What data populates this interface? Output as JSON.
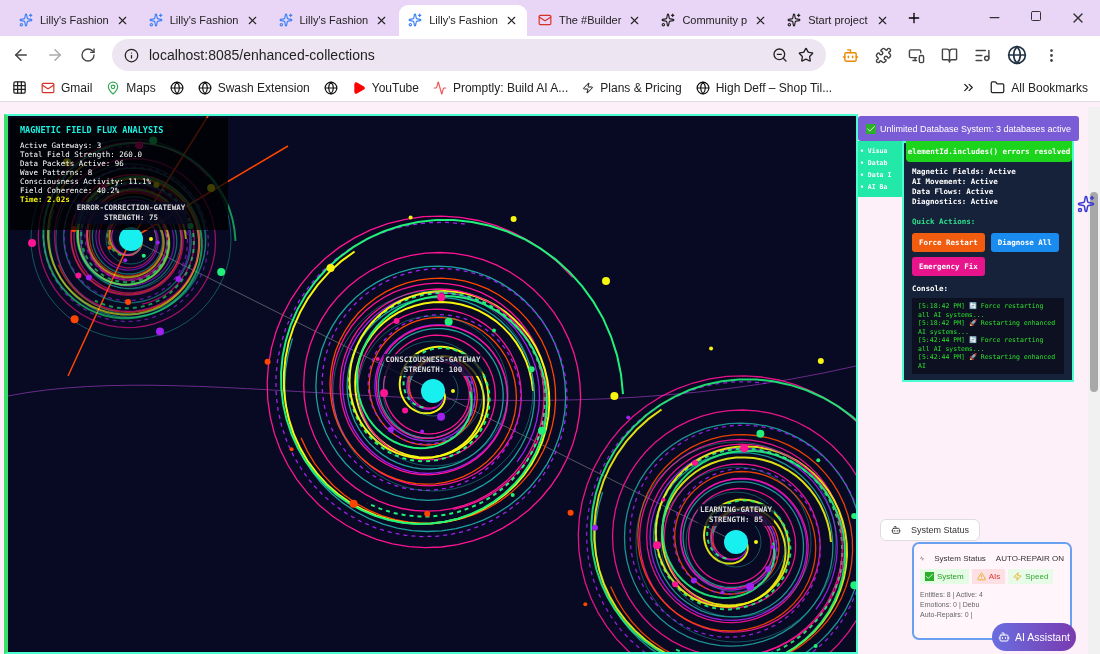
{
  "tabs": [
    {
      "title": "Lilly's Fashion",
      "kind": "app",
      "selected": false
    },
    {
      "title": "Lilly's Fashion",
      "kind": "app",
      "selected": false
    },
    {
      "title": "Lilly's Fashion",
      "kind": "app",
      "selected": false
    },
    {
      "title": "Lilly's Fashion",
      "kind": "app",
      "selected": true
    },
    {
      "title": "The #Builder",
      "kind": "mail",
      "selected": false
    },
    {
      "title": "Community p",
      "kind": "star",
      "selected": false
    },
    {
      "title": "Start project",
      "kind": "star",
      "selected": false
    }
  ],
  "address": "localhost:8085/enhanced-collections",
  "bookmarks": [
    {
      "label": "Gmail",
      "kind": "mail"
    },
    {
      "label": "Maps",
      "kind": "pin"
    },
    {
      "kind": "globe"
    },
    {
      "label": "Swash Extension",
      "kind": "globe"
    },
    {
      "kind": "globe"
    },
    {
      "label": "YouTube",
      "kind": "play"
    },
    {
      "label": "Promptly: Build AI A...",
      "kind": "prompt"
    },
    {
      "label": "Plans & Pricing",
      "kind": "wix"
    },
    {
      "label": "High Deff – Shop Til...",
      "kind": "globe"
    }
  ],
  "all_bookmarks": "All Bookmarks",
  "flux_panel": {
    "title": "MAGNETIC FIELD FLUX ANALYSIS",
    "stats": [
      "Active Gateways: 3",
      "Total Field Strength: 260.0",
      "Data Packets Active: 96",
      "Wave Patterns: 8",
      "Consciousness Activity: 11.1%",
      "Field Coherence: 40.2%"
    ],
    "time": "Time: 2.02s"
  },
  "gateways": [
    {
      "name": "ERROR-CORRECTION-GATEWAY",
      "strength": "STRENGTH: 75"
    },
    {
      "name": "CONSCIOUSNESS-GATEWAY",
      "strength": "STRENGTH: 100"
    },
    {
      "name": "LEARNING-GATEWAY",
      "strength": "STRENGTH: 85"
    }
  ],
  "db_toast": "Unlimited Database System: 3 databases active",
  "side_list": [
    "• Visua",
    "• Datab",
    "• Data I",
    "• AI Ba"
  ],
  "fix_toast": "elementId.includes() errors resolved",
  "control_panel": {
    "statuses": [
      "Magnetic Fields: Active",
      "AI Movement: Active",
      "Data Flows: Active",
      "Diagnostics: Active"
    ],
    "quick_actions": "Quick Actions:",
    "actions": [
      {
        "label": "Force Restart",
        "color": "#f25c0f"
      },
      {
        "label": "Diagnose All",
        "color": "#1a8cf0"
      },
      {
        "label": "Emergency Fix",
        "color": "#e8148c"
      }
    ],
    "console_label": "Console:",
    "console": [
      "[5:18:42 PM] 🔄 Force restarting all AI systems...",
      "[5:18:42 PM] 🚀 Restarting enhanced AI systems...",
      "[5:42:44 PM] 🔄 Force restarting all AI systems...",
      "[5:42:44 PM] 🚀 Restarting enhanced AI"
    ]
  },
  "status_pill": "System Status",
  "status_card": {
    "title": "System Status",
    "mode": "AUTO-REPAIR ON",
    "chips": [
      {
        "label": "System",
        "kind": "ok"
      },
      {
        "label": "AIs",
        "kind": "warn"
      },
      {
        "label": "Speed",
        "kind": "fast"
      }
    ],
    "lines": [
      "Entities: 8 | Active: 4",
      "Emotions: 0 | Debu",
      "Auto-Repairs: 0 |"
    ]
  },
  "assistant_button": "AI Assistant"
}
